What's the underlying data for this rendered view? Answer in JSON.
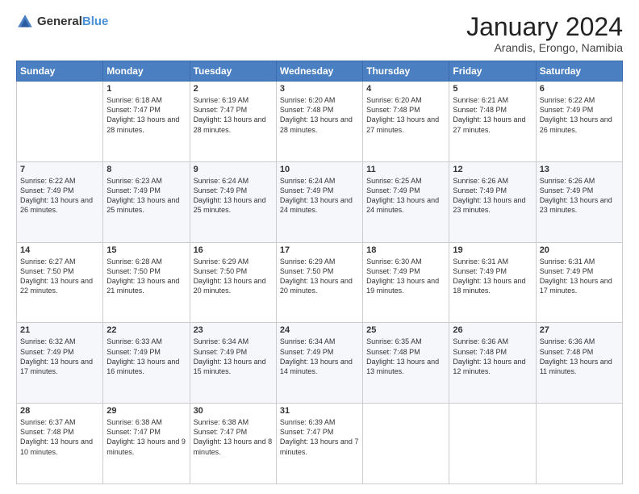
{
  "logo": {
    "general": "General",
    "blue": "Blue"
  },
  "header": {
    "month_year": "January 2024",
    "location": "Arandis, Erongo, Namibia"
  },
  "weekdays": [
    "Sunday",
    "Monday",
    "Tuesday",
    "Wednesday",
    "Thursday",
    "Friday",
    "Saturday"
  ],
  "weeks": [
    [
      {
        "day": "",
        "sunrise": "",
        "sunset": "",
        "daylight": ""
      },
      {
        "day": "1",
        "sunrise": "Sunrise: 6:18 AM",
        "sunset": "Sunset: 7:47 PM",
        "daylight": "Daylight: 13 hours and 28 minutes."
      },
      {
        "day": "2",
        "sunrise": "Sunrise: 6:19 AM",
        "sunset": "Sunset: 7:47 PM",
        "daylight": "Daylight: 13 hours and 28 minutes."
      },
      {
        "day": "3",
        "sunrise": "Sunrise: 6:20 AM",
        "sunset": "Sunset: 7:48 PM",
        "daylight": "Daylight: 13 hours and 28 minutes."
      },
      {
        "day": "4",
        "sunrise": "Sunrise: 6:20 AM",
        "sunset": "Sunset: 7:48 PM",
        "daylight": "Daylight: 13 hours and 27 minutes."
      },
      {
        "day": "5",
        "sunrise": "Sunrise: 6:21 AM",
        "sunset": "Sunset: 7:48 PM",
        "daylight": "Daylight: 13 hours and 27 minutes."
      },
      {
        "day": "6",
        "sunrise": "Sunrise: 6:22 AM",
        "sunset": "Sunset: 7:49 PM",
        "daylight": "Daylight: 13 hours and 26 minutes."
      }
    ],
    [
      {
        "day": "7",
        "sunrise": "Sunrise: 6:22 AM",
        "sunset": "Sunset: 7:49 PM",
        "daylight": "Daylight: 13 hours and 26 minutes."
      },
      {
        "day": "8",
        "sunrise": "Sunrise: 6:23 AM",
        "sunset": "Sunset: 7:49 PM",
        "daylight": "Daylight: 13 hours and 25 minutes."
      },
      {
        "day": "9",
        "sunrise": "Sunrise: 6:24 AM",
        "sunset": "Sunset: 7:49 PM",
        "daylight": "Daylight: 13 hours and 25 minutes."
      },
      {
        "day": "10",
        "sunrise": "Sunrise: 6:24 AM",
        "sunset": "Sunset: 7:49 PM",
        "daylight": "Daylight: 13 hours and 24 minutes."
      },
      {
        "day": "11",
        "sunrise": "Sunrise: 6:25 AM",
        "sunset": "Sunset: 7:49 PM",
        "daylight": "Daylight: 13 hours and 24 minutes."
      },
      {
        "day": "12",
        "sunrise": "Sunrise: 6:26 AM",
        "sunset": "Sunset: 7:49 PM",
        "daylight": "Daylight: 13 hours and 23 minutes."
      },
      {
        "day": "13",
        "sunrise": "Sunrise: 6:26 AM",
        "sunset": "Sunset: 7:49 PM",
        "daylight": "Daylight: 13 hours and 23 minutes."
      }
    ],
    [
      {
        "day": "14",
        "sunrise": "Sunrise: 6:27 AM",
        "sunset": "Sunset: 7:50 PM",
        "daylight": "Daylight: 13 hours and 22 minutes."
      },
      {
        "day": "15",
        "sunrise": "Sunrise: 6:28 AM",
        "sunset": "Sunset: 7:50 PM",
        "daylight": "Daylight: 13 hours and 21 minutes."
      },
      {
        "day": "16",
        "sunrise": "Sunrise: 6:29 AM",
        "sunset": "Sunset: 7:50 PM",
        "daylight": "Daylight: 13 hours and 20 minutes."
      },
      {
        "day": "17",
        "sunrise": "Sunrise: 6:29 AM",
        "sunset": "Sunset: 7:50 PM",
        "daylight": "Daylight: 13 hours and 20 minutes."
      },
      {
        "day": "18",
        "sunrise": "Sunrise: 6:30 AM",
        "sunset": "Sunset: 7:49 PM",
        "daylight": "Daylight: 13 hours and 19 minutes."
      },
      {
        "day": "19",
        "sunrise": "Sunrise: 6:31 AM",
        "sunset": "Sunset: 7:49 PM",
        "daylight": "Daylight: 13 hours and 18 minutes."
      },
      {
        "day": "20",
        "sunrise": "Sunrise: 6:31 AM",
        "sunset": "Sunset: 7:49 PM",
        "daylight": "Daylight: 13 hours and 17 minutes."
      }
    ],
    [
      {
        "day": "21",
        "sunrise": "Sunrise: 6:32 AM",
        "sunset": "Sunset: 7:49 PM",
        "daylight": "Daylight: 13 hours and 17 minutes."
      },
      {
        "day": "22",
        "sunrise": "Sunrise: 6:33 AM",
        "sunset": "Sunset: 7:49 PM",
        "daylight": "Daylight: 13 hours and 16 minutes."
      },
      {
        "day": "23",
        "sunrise": "Sunrise: 6:34 AM",
        "sunset": "Sunset: 7:49 PM",
        "daylight": "Daylight: 13 hours and 15 minutes."
      },
      {
        "day": "24",
        "sunrise": "Sunrise: 6:34 AM",
        "sunset": "Sunset: 7:49 PM",
        "daylight": "Daylight: 13 hours and 14 minutes."
      },
      {
        "day": "25",
        "sunrise": "Sunrise: 6:35 AM",
        "sunset": "Sunset: 7:48 PM",
        "daylight": "Daylight: 13 hours and 13 minutes."
      },
      {
        "day": "26",
        "sunrise": "Sunrise: 6:36 AM",
        "sunset": "Sunset: 7:48 PM",
        "daylight": "Daylight: 13 hours and 12 minutes."
      },
      {
        "day": "27",
        "sunrise": "Sunrise: 6:36 AM",
        "sunset": "Sunset: 7:48 PM",
        "daylight": "Daylight: 13 hours and 11 minutes."
      }
    ],
    [
      {
        "day": "28",
        "sunrise": "Sunrise: 6:37 AM",
        "sunset": "Sunset: 7:48 PM",
        "daylight": "Daylight: 13 hours and 10 minutes."
      },
      {
        "day": "29",
        "sunrise": "Sunrise: 6:38 AM",
        "sunset": "Sunset: 7:47 PM",
        "daylight": "Daylight: 13 hours and 9 minutes."
      },
      {
        "day": "30",
        "sunrise": "Sunrise: 6:38 AM",
        "sunset": "Sunset: 7:47 PM",
        "daylight": "Daylight: 13 hours and 8 minutes."
      },
      {
        "day": "31",
        "sunrise": "Sunrise: 6:39 AM",
        "sunset": "Sunset: 7:47 PM",
        "daylight": "Daylight: 13 hours and 7 minutes."
      },
      {
        "day": "",
        "sunrise": "",
        "sunset": "",
        "daylight": ""
      },
      {
        "day": "",
        "sunrise": "",
        "sunset": "",
        "daylight": ""
      },
      {
        "day": "",
        "sunrise": "",
        "sunset": "",
        "daylight": ""
      }
    ]
  ]
}
